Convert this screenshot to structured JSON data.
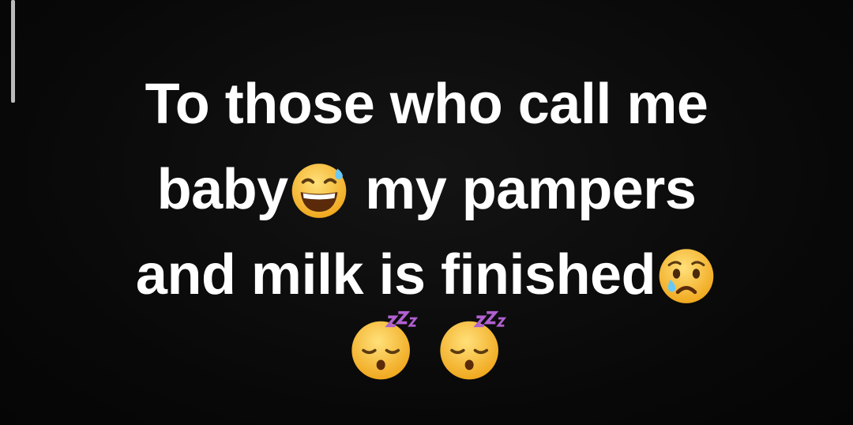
{
  "caption": {
    "line1": "To those who call me",
    "line2_before": "baby",
    "line2_after": " my pampers",
    "line3": "and milk is finished"
  },
  "emojis": {
    "line2": "grinning-face-with-sweat-icon",
    "line3": "crying-face-icon",
    "row": [
      "sleeping-face-icon",
      "sleeping-face-icon"
    ]
  },
  "colors": {
    "background": "#0a0a0a",
    "text": "#ffffff",
    "emoji_face": "#f7c23c"
  }
}
